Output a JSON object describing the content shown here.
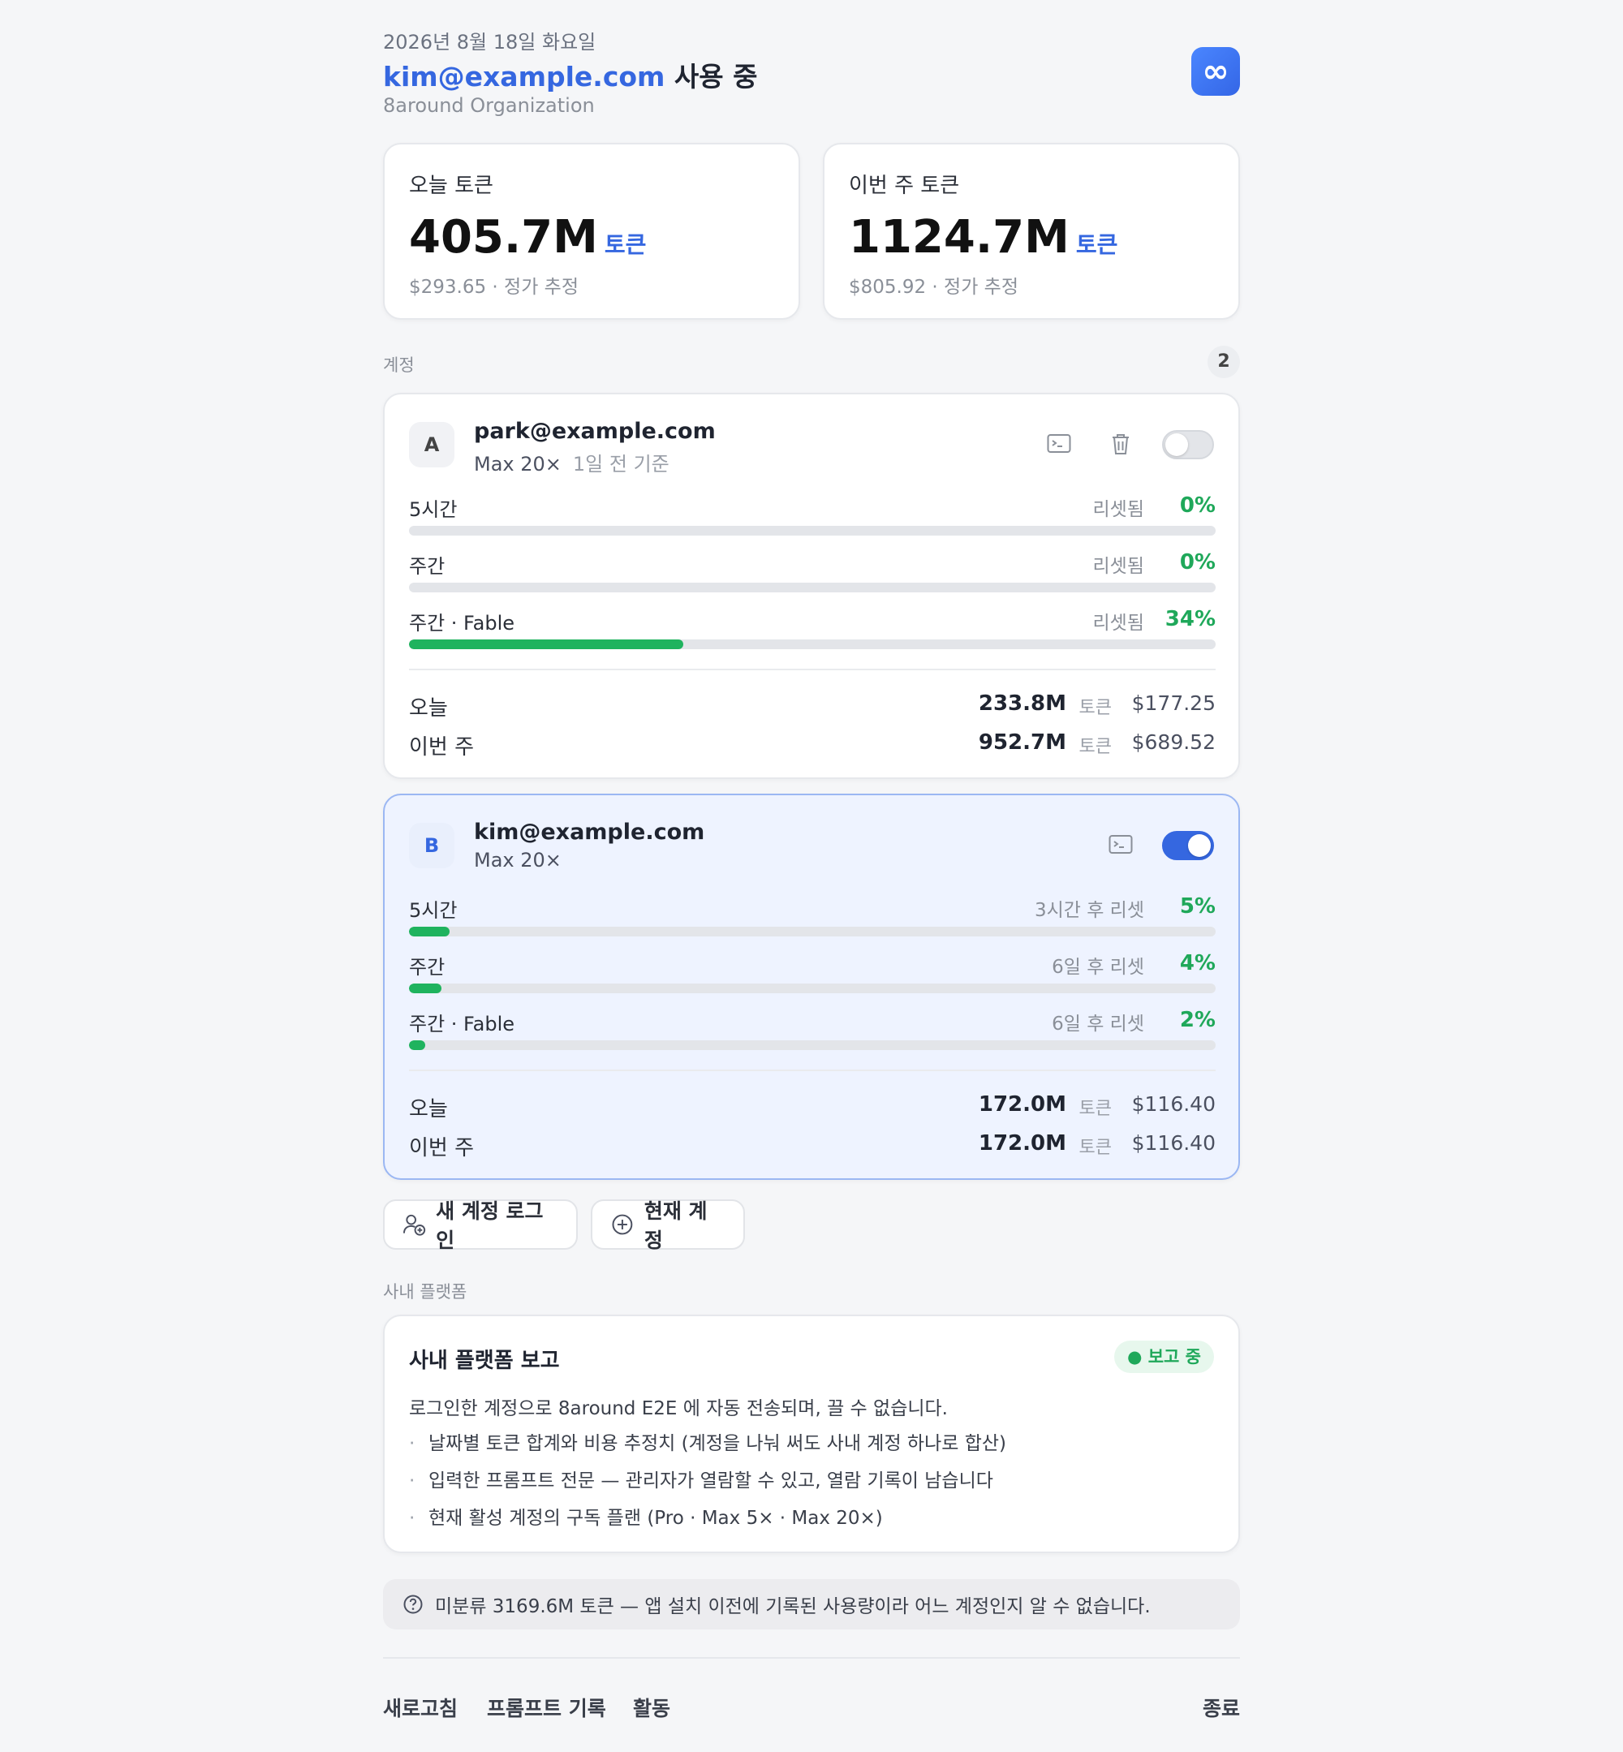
{
  "header": {
    "date": "2026년 8월 18일 화요일",
    "email": "kim@example.com",
    "status_suffix": " 사용 중",
    "org": "8around Organization",
    "logo_glyph": "∞"
  },
  "summary": [
    {
      "label": "오늘 토큰",
      "value": "405.7M",
      "unit": "토큰",
      "sub": "$293.65 · 정가 추정"
    },
    {
      "label": "이번 주 토큰",
      "value": "1124.7M",
      "unit": "토큰",
      "sub": "$805.92 · 정가 추정"
    }
  ],
  "accounts_section": {
    "label": "계정",
    "count": "2"
  },
  "accounts": [
    {
      "avatar": "A",
      "email": "park@example.com",
      "plan": "Max 20×",
      "updated": "1일 전 기준",
      "enabled": false,
      "limits": [
        {
          "label": "5시간",
          "reset": "리셋됨",
          "percent": "0%",
          "fill": 0
        },
        {
          "label": "주간",
          "reset": "리셋됨",
          "percent": "0%",
          "fill": 0
        },
        {
          "label": "주간 · Fable",
          "reset": "리셋됨",
          "percent": "34%",
          "fill": 34
        }
      ],
      "usage": [
        {
          "label": "오늘",
          "tokens": "233.8M",
          "unit": "토큰",
          "cost": "$177.25"
        },
        {
          "label": "이번 주",
          "tokens": "952.7M",
          "unit": "토큰",
          "cost": "$689.52"
        }
      ]
    },
    {
      "avatar": "B",
      "email": "kim@example.com",
      "plan": "Max 20×",
      "updated": "",
      "enabled": true,
      "limits": [
        {
          "label": "5시간",
          "reset": "3시간 후 리셋",
          "percent": "5%",
          "fill": 5
        },
        {
          "label": "주간",
          "reset": "6일 후 리셋",
          "percent": "4%",
          "fill": 4
        },
        {
          "label": "주간 · Fable",
          "reset": "6일 후 리셋",
          "percent": "2%",
          "fill": 2
        }
      ],
      "usage": [
        {
          "label": "오늘",
          "tokens": "172.0M",
          "unit": "토큰",
          "cost": "$116.40"
        },
        {
          "label": "이번 주",
          "tokens": "172.0M",
          "unit": "토큰",
          "cost": "$116.40"
        }
      ]
    }
  ],
  "actions": {
    "new_login": "새 계정 로그인",
    "current_account": "현재 계정"
  },
  "platform_section": {
    "label": "사내 플랫폼"
  },
  "platform": {
    "title": "사내 플랫폼 보고",
    "badge": "● 보고 중",
    "description": "로그인한 계정으로 8around E2E 에 자동 전송되며, 끌 수 없습니다.",
    "items": [
      "날짜별 토큰 합계와 비용 추정치 (계정을 나눠 써도 사내 계정 하나로 합산)",
      "입력한 프롬프트 전문 — 관리자가 열람할 수 있고, 열람 기록이 남습니다",
      "현재 활성 계정의 구독 플랜 (Pro · Max 5× · Max 20×)"
    ]
  },
  "notice": "미분류 3169.6M 토큰 — 앱 설치 이전에 기록된 사용량이라 어느 계정인지 알 수 없습니다.",
  "footer": {
    "refresh": "새로고침",
    "prompt_history": "프롬프트 기록",
    "activity": "활동",
    "quit": "종료"
  },
  "colors": {
    "accent": "#3567e0",
    "success": "#1fb35e",
    "active_bg": "#eef3ff"
  }
}
